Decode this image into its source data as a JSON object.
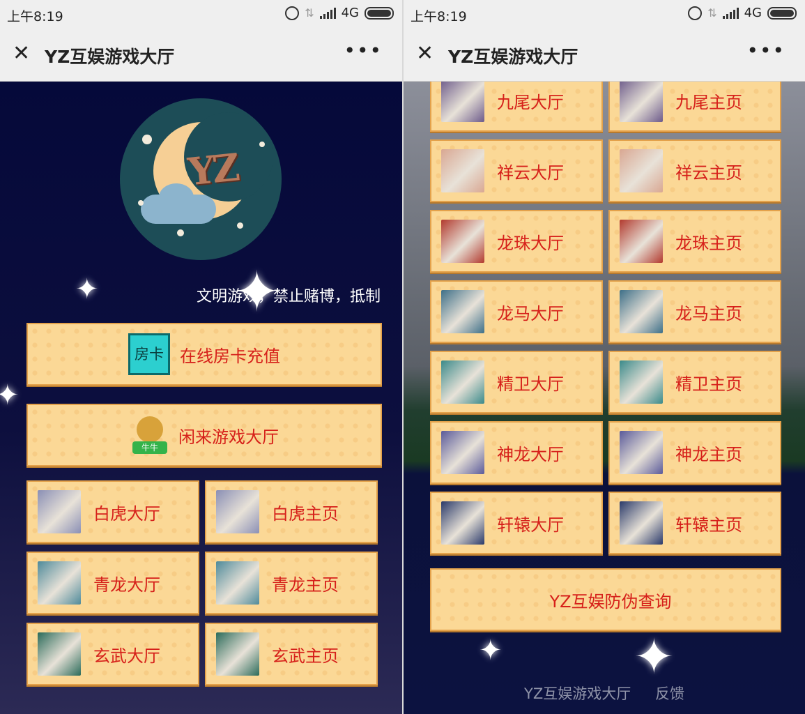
{
  "status_bar": {
    "time": "上午8:19",
    "network": "4G"
  },
  "window": {
    "title": "YZ互娱游戏大厅",
    "close_icon": "close-icon",
    "more_icon": "more-icon"
  },
  "logo": {
    "text": "YZ"
  },
  "notice": {
    "text": "文明游戏，禁止赌博，抵制"
  },
  "left_buttons": {
    "recharge": {
      "label": "在线房卡充值",
      "badge_text": "房卡",
      "icon": "fangka-icon"
    },
    "xianlai": {
      "label": "闲来游戏大厅",
      "icon": "niuniu-icon",
      "badge_text": "牛牛"
    }
  },
  "left_grid": [
    {
      "hall": "白虎大厅",
      "home": "白虎主页",
      "color": "#8a8fb5"
    },
    {
      "hall": "青龙大厅",
      "home": "青龙主页",
      "color": "#4e8a9a"
    },
    {
      "hall": "玄武大厅",
      "home": "玄武主页",
      "color": "#2b6b5a"
    }
  ],
  "right_grid": [
    {
      "hall": "九尾大厅",
      "home": "九尾主页",
      "color": "#6c5a8a"
    },
    {
      "hall": "祥云大厅",
      "home": "祥云主页",
      "color": "#d9a792"
    },
    {
      "hall": "龙珠大厅",
      "home": "龙珠主页",
      "color": "#b23a2e"
    },
    {
      "hall": "龙马大厅",
      "home": "龙马主页",
      "color": "#3d6f88"
    },
    {
      "hall": "精卫大厅",
      "home": "精卫主页",
      "color": "#3a8a8a"
    },
    {
      "hall": "神龙大厅",
      "home": "神龙主页",
      "color": "#5a5a9a"
    },
    {
      "hall": "轩辕大厅",
      "home": "轩辕主页",
      "color": "#2a3a6a"
    }
  ],
  "anti_fake": {
    "label": "YZ互娱防伪查询"
  },
  "footer": {
    "site_name": "YZ互娱游戏大厅",
    "feedback": "反馈"
  }
}
